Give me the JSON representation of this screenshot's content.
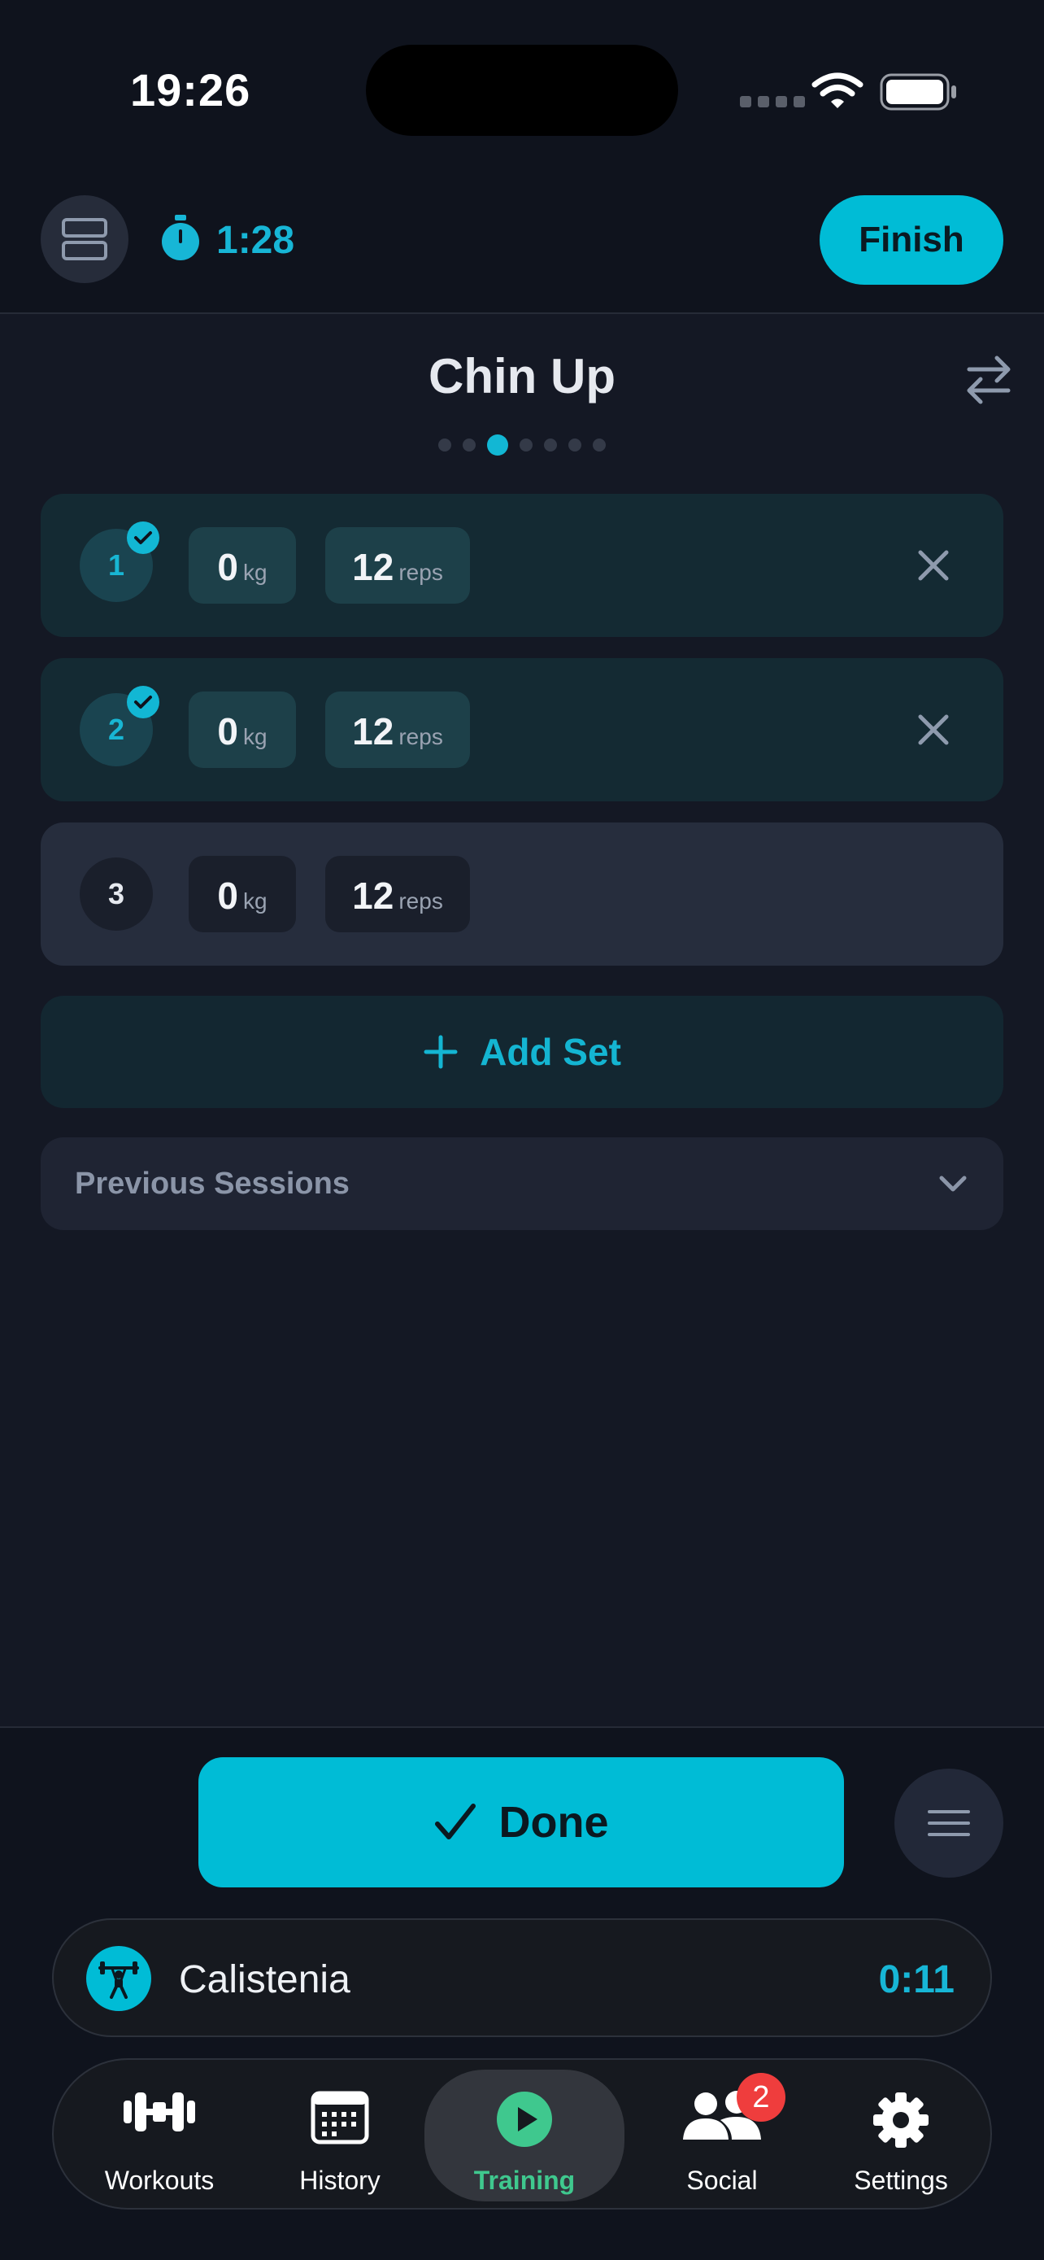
{
  "status_bar": {
    "time": "19:26"
  },
  "header": {
    "timer": "1:28",
    "finish_label": "Finish"
  },
  "exercise": {
    "title": "Chin Up",
    "page_count": 7,
    "active_page": 3,
    "sets": [
      {
        "number": "1",
        "weight": "0",
        "weight_unit": "kg",
        "reps": "12",
        "reps_unit": "reps",
        "completed": true
      },
      {
        "number": "2",
        "weight": "0",
        "weight_unit": "kg",
        "reps": "12",
        "reps_unit": "reps",
        "completed": true
      },
      {
        "number": "3",
        "weight": "0",
        "weight_unit": "kg",
        "reps": "12",
        "reps_unit": "reps",
        "completed": false
      }
    ],
    "add_set_label": "Add Set",
    "previous_sessions_label": "Previous Sessions"
  },
  "actions": {
    "done_label": "Done"
  },
  "workout_bar": {
    "name": "Calistenia",
    "elapsed": "0:11"
  },
  "tabs": [
    {
      "label": "Workouts",
      "icon": "dumbbell-icon"
    },
    {
      "label": "History",
      "icon": "calendar-icon"
    },
    {
      "label": "Training",
      "icon": "play-icon",
      "active": true
    },
    {
      "label": "Social",
      "icon": "users-icon",
      "badge": "2"
    },
    {
      "label": "Settings",
      "icon": "gear-icon"
    }
  ],
  "colors": {
    "accent": "#00bcd6",
    "active_tab": "#3fc88e",
    "badge": "#ef3d3d",
    "background": "#141824"
  }
}
